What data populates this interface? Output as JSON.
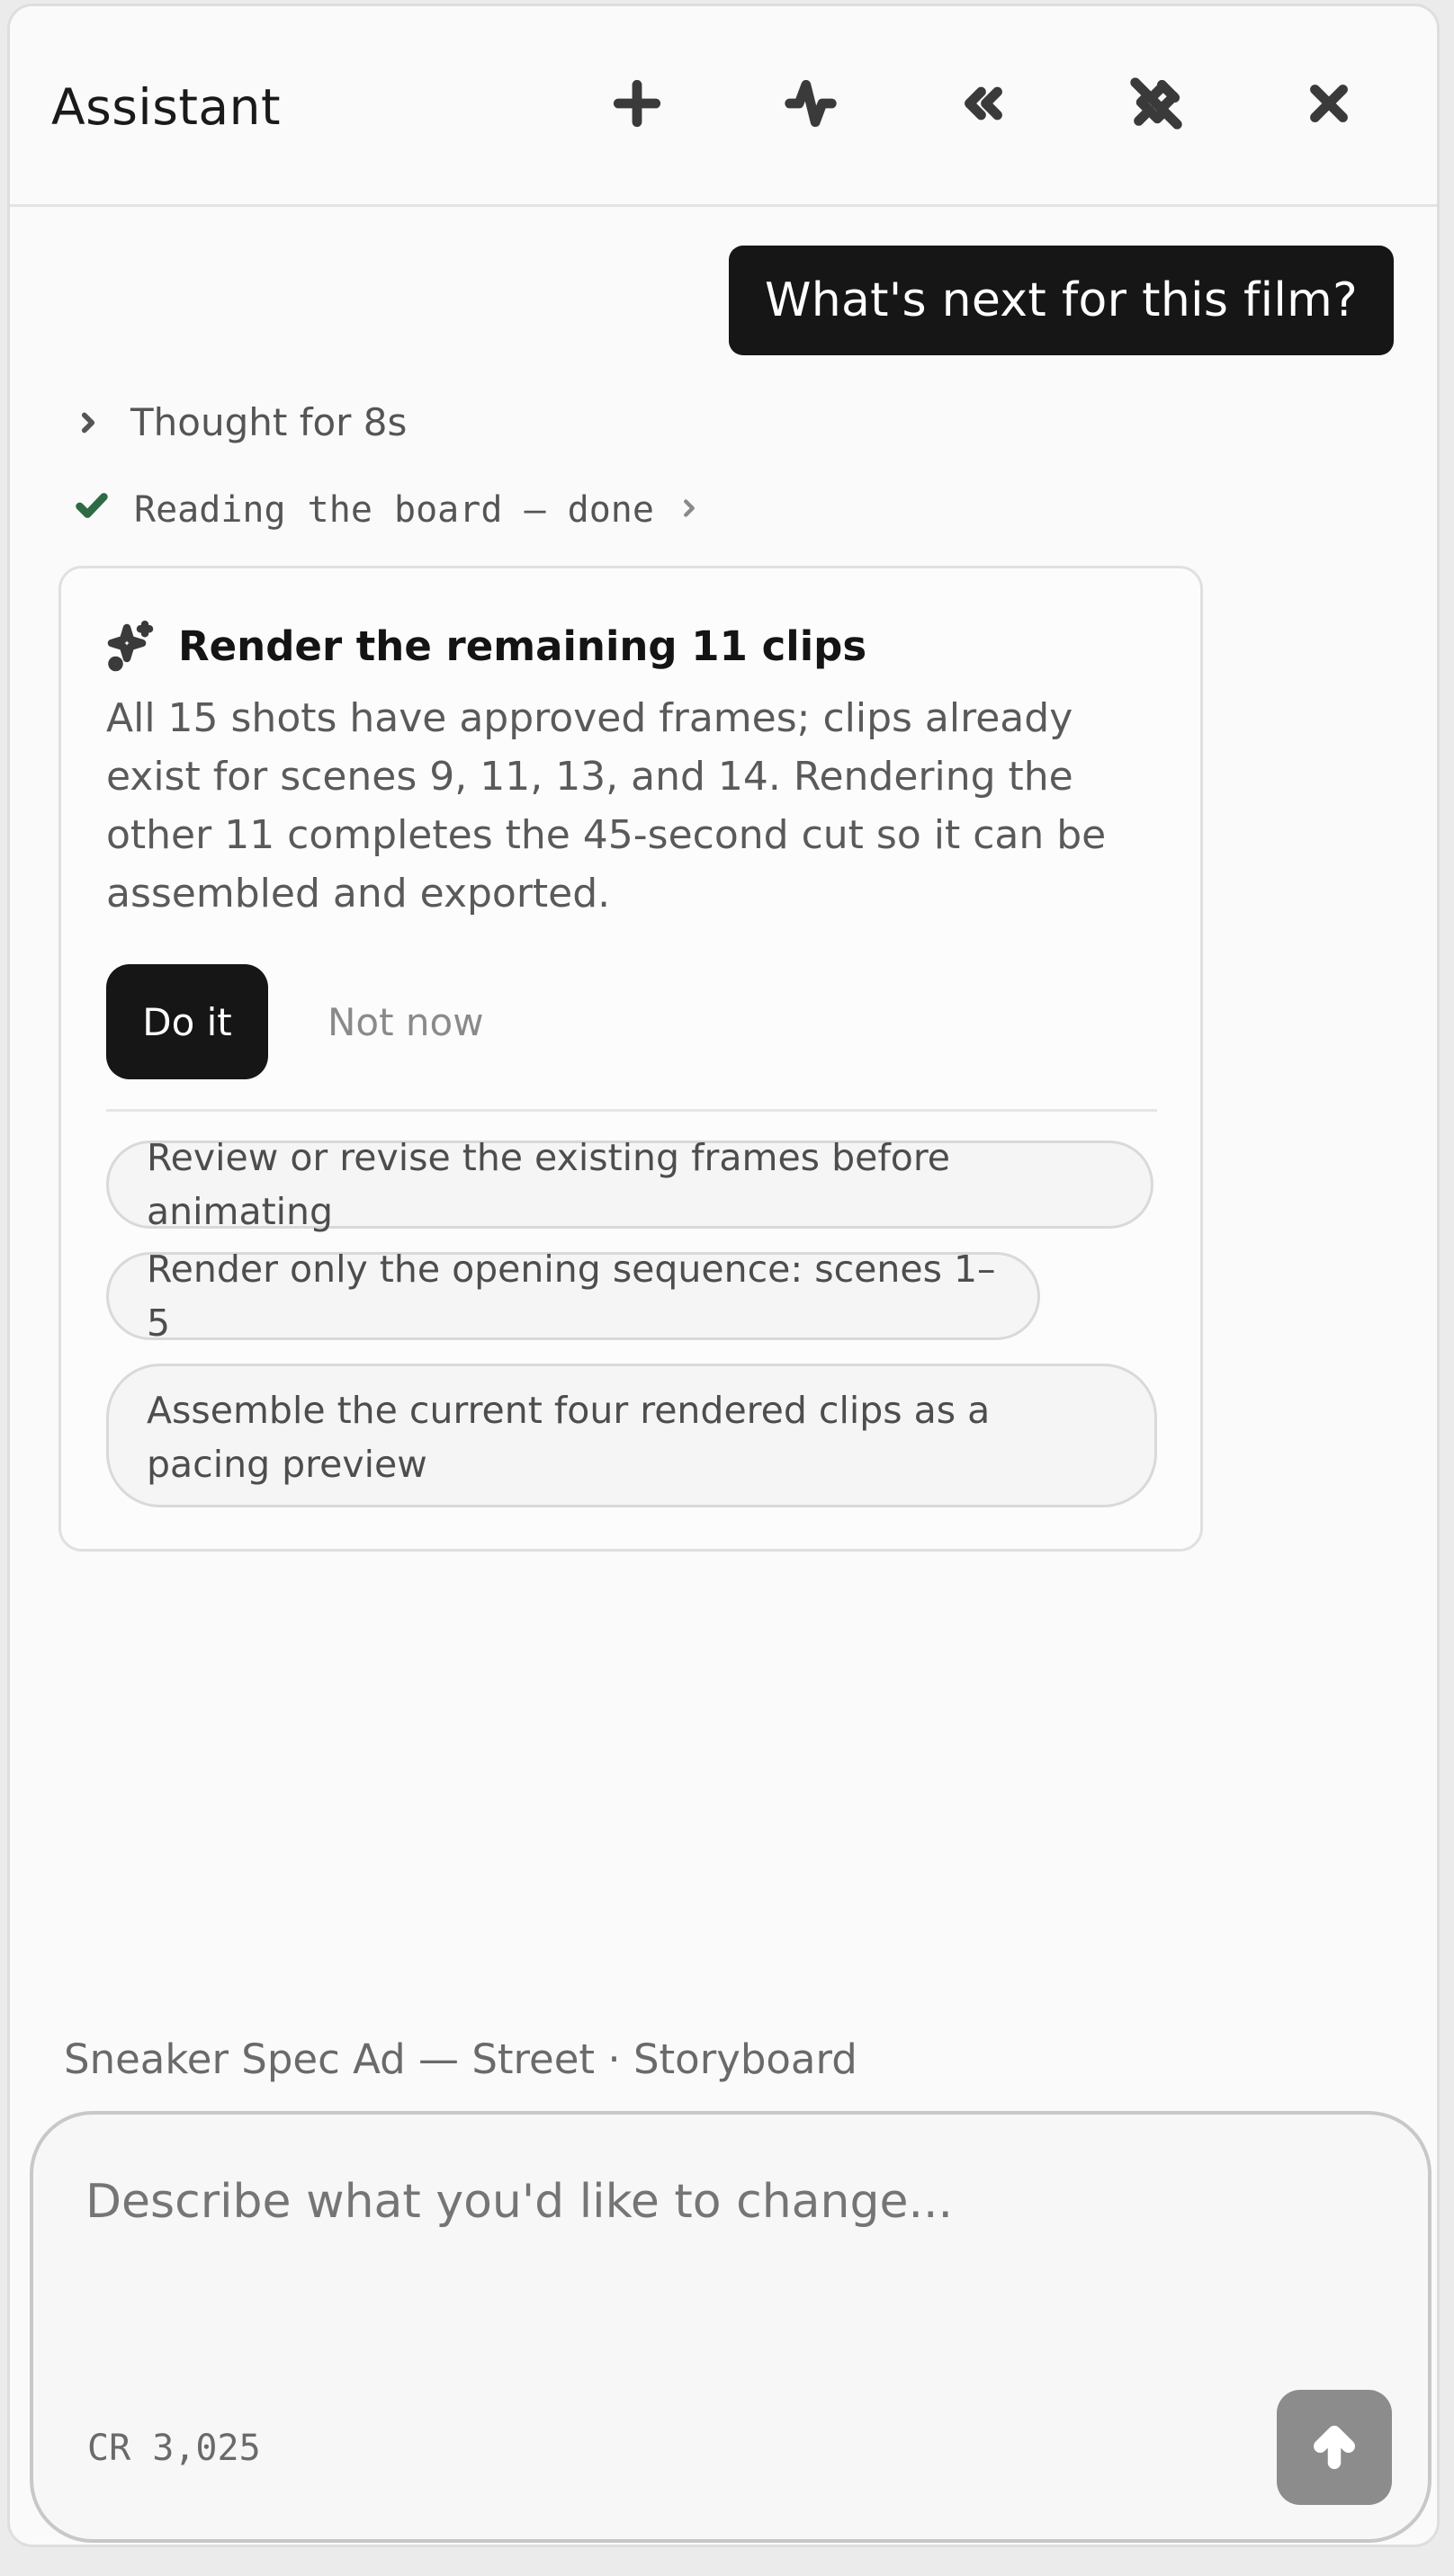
{
  "header": {
    "title": "Assistant",
    "icons": [
      "plus-icon",
      "activity-icon",
      "chevrons-left-icon",
      "pin-off-icon",
      "close-icon"
    ]
  },
  "conversation": {
    "user_message": "What's next for this film?",
    "thought_label": "Thought for 8s",
    "step_label": "Reading the board — done"
  },
  "suggestion_card": {
    "title": "Render the remaining 11 clips",
    "body": "All 15 shots have approved frames; clips already exist for scenes 9, 11, 13, and 14. Rendering the other 11 completes the 45-second cut so it can be assembled and exported.",
    "primary_action": "Do it",
    "secondary_action": "Not now",
    "alternatives": [
      "Review or revise the existing frames before animating",
      "Render only the opening sequence: scenes 1–5",
      "Assemble the current four rendered clips as a pacing preview"
    ]
  },
  "composer": {
    "context": "Sneaker Spec Ad — Street · Storyboard",
    "placeholder": "Describe what you'd like to change...",
    "credits": "CR 3,025"
  },
  "colors": {
    "accent_dark": "#161616",
    "check_green": "#2e6b45",
    "send_disabled": "#8c8c8c"
  }
}
